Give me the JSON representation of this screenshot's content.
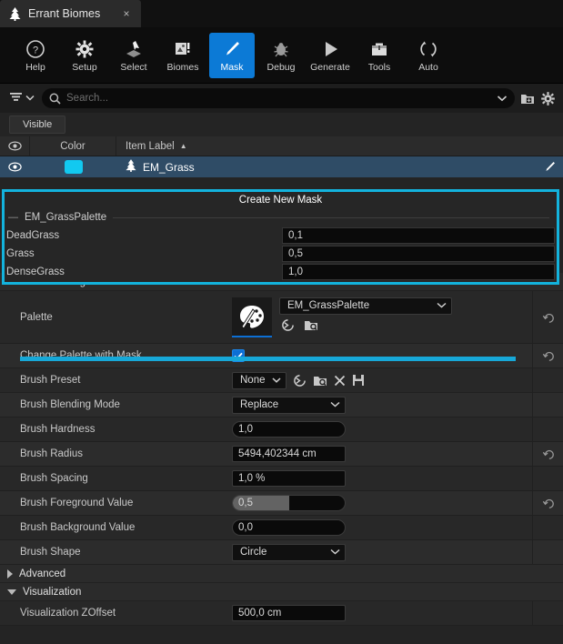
{
  "tab": {
    "title": "Errant Biomes",
    "close": "×",
    "icon": "tree-icon"
  },
  "toolbar": {
    "items": [
      {
        "label": "Help",
        "icon": "help-circle-icon",
        "active": false
      },
      {
        "label": "Setup",
        "icon": "gear-icon",
        "active": false
      },
      {
        "label": "Select",
        "icon": "cursor-select-icon",
        "active": false
      },
      {
        "label": "Biomes",
        "icon": "biomes-image-icon",
        "active": false
      },
      {
        "label": "Mask",
        "icon": "brush-icon",
        "active": true
      },
      {
        "label": "Debug",
        "icon": "bug-icon",
        "active": false
      },
      {
        "label": "Generate",
        "icon": "play-icon",
        "active": false
      },
      {
        "label": "Tools",
        "icon": "toolbox-icon",
        "active": false
      },
      {
        "label": "Auto",
        "icon": "refresh-icon",
        "active": false
      }
    ],
    "active_color": "#0c7ad6"
  },
  "search": {
    "placeholder": "Search...",
    "value": "",
    "filter_icon": "filter-icon",
    "search_icon": "search-icon",
    "add_icon": "add-folder-icon",
    "settings_icon": "gear-icon"
  },
  "filters": {
    "visible_label": "Visible"
  },
  "list": {
    "columns": {
      "eye": "eye-icon",
      "color": "Color",
      "item_label": "Item Label",
      "sort": "▲"
    },
    "rows": [
      {
        "visible_icon": "eye-icon",
        "color": "#12c9f0",
        "icon": "tree-icon",
        "label": "EM_Grass",
        "edit_icon": "brush-icon",
        "selected": true
      }
    ]
  },
  "create_mask_overlay": {
    "title": "Create New Mask",
    "group_name": "EM_GrassPalette",
    "collapse_glyph": "—",
    "border_color": "#13b3dd",
    "entries": [
      {
        "name": "DeadGrass",
        "value": "0,1"
      },
      {
        "name": "Grass",
        "value": "0,5"
      },
      {
        "name": "DenseGrass",
        "value": "1,0"
      }
    ]
  },
  "sections": {
    "brush_settings": {
      "label": "Brush Settings",
      "expanded": true
    },
    "advanced": {
      "label": "Advanced",
      "expanded": false
    },
    "visualization": {
      "label": "Visualization",
      "expanded": true
    }
  },
  "properties": {
    "palette": {
      "label": "Palette",
      "thumb_icon": "palette-icon",
      "value": "EM_GrassPalette",
      "use_selected_icon": "use-selected-icon",
      "browse_icon": "browse-icon",
      "reset_icon": "reset-icon"
    },
    "change_palette_with_mask": {
      "label": "Change Palette with Mask",
      "checked": true,
      "reset_icon": "reset-icon"
    },
    "brush_preset": {
      "label": "Brush Preset",
      "value": "None",
      "use_selected_icon": "use-selected-icon",
      "browse_icon": "browse-icon",
      "clear_icon": "close-icon",
      "save_icon": "save-icon"
    },
    "brush_blending_mode": {
      "label": "Brush Blending Mode",
      "value": "Replace"
    },
    "brush_hardness": {
      "label": "Brush Hardness",
      "value": "1,0"
    },
    "brush_radius": {
      "label": "Brush Radius",
      "value": "5494,402344 cm",
      "reset_icon": "reset-icon"
    },
    "brush_spacing": {
      "label": "Brush Spacing",
      "value": "1,0 %"
    },
    "brush_foreground_value": {
      "label": "Brush Foreground Value",
      "value": "0,5",
      "fill_percent": 50,
      "reset_icon": "reset-icon"
    },
    "brush_background_value": {
      "label": "Brush Background Value",
      "value": "0,0"
    },
    "brush_shape": {
      "label": "Brush Shape",
      "value": "Circle"
    },
    "visualization_zoffset": {
      "label": "Visualization ZOffset",
      "value": "500,0 cm"
    }
  }
}
